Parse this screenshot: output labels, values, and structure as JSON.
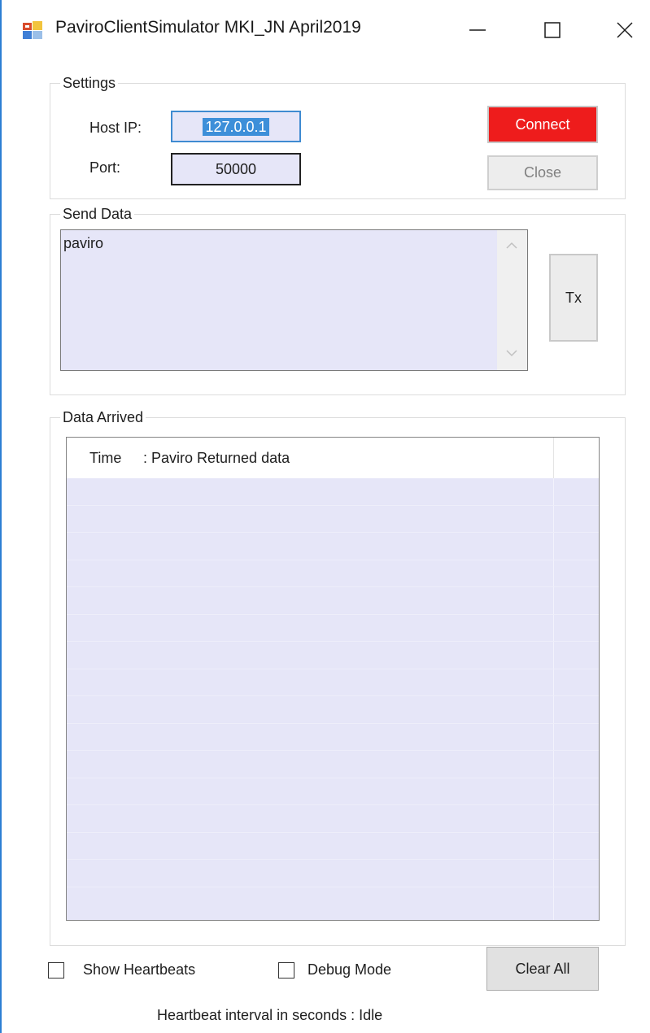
{
  "window": {
    "title": "PaviroClientSimulator MKI_JN April2019",
    "app_icon": "app-window-icon",
    "controls": [
      "minimize-icon",
      "maximize-icon",
      "close-icon"
    ]
  },
  "settings": {
    "group_label": "Settings",
    "host_ip_label": "Host IP:",
    "host_ip_value": "127.0.0.1",
    "port_label": "Port:",
    "port_value": "50000",
    "connect_label": "Connect",
    "close_label": "Close"
  },
  "send": {
    "group_label": "Send Data",
    "text": "paviro",
    "tx_label": "Tx"
  },
  "arrived": {
    "group_label": "Data Arrived",
    "col_time": "Time",
    "col_data": ": Paviro Returned data",
    "rows": []
  },
  "footer": {
    "show_heartbeats_label": "Show Heartbeats",
    "show_heartbeats_checked": false,
    "debug_mode_label": "Debug Mode",
    "debug_mode_checked": false,
    "clear_all_label": "Clear All",
    "heartbeat_status": "Heartbeat interval in seconds :  Idle"
  },
  "colors": {
    "connect_button": "#ee1c1c",
    "field_background": "#e6e6f8",
    "selection": "#3d8fd9"
  }
}
